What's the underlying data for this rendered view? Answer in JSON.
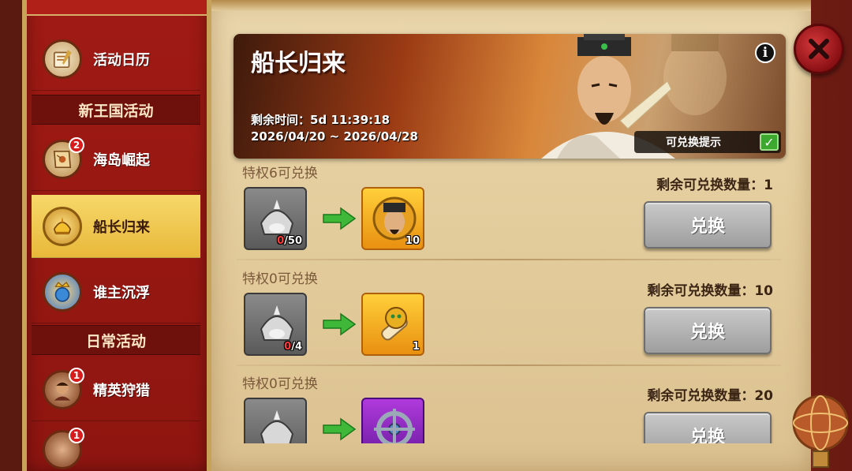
{
  "sidebar": {
    "items": [
      {
        "label": "活动日历",
        "badge": null,
        "active": false,
        "icon": "scroll-quill-icon"
      },
      {
        "label": "海岛崛起",
        "badge": "2",
        "active": false,
        "icon": "treasure-map-icon"
      },
      {
        "label": "船长归来",
        "badge": null,
        "active": true,
        "icon": "gold-helmet-icon"
      },
      {
        "label": "谁主沉浮",
        "badge": null,
        "active": false,
        "icon": "crown-globe-icon"
      },
      {
        "label": "精英狩猎",
        "badge": "1",
        "active": false,
        "icon": "warrior-portrait-icon"
      },
      {
        "label": "",
        "badge": "1",
        "active": false,
        "icon": "partial-avatar-icon"
      }
    ],
    "sections": [
      "新王国活动",
      "日常活动"
    ]
  },
  "banner": {
    "title": "船长归来",
    "remaining": "剩余时间：5d 11:39:18",
    "dates": "2026/04/20 ~ 2026/04/28",
    "info_icon": "i",
    "hint_label": "可兑换提示",
    "hint_checked": true
  },
  "rows": [
    {
      "title": "特权6可兑换",
      "remain": "剩余可兑换数量：1",
      "cost_have": "0",
      "cost_need": "/50",
      "reward_count": "10",
      "reward_type": "gold",
      "reward_icon": "captain-portrait-icon",
      "button": "兑换"
    },
    {
      "title": "特权0可兑换",
      "remain": "剩余可兑换数量：10",
      "cost_have": "0",
      "cost_need": "/4",
      "reward_count": "1",
      "reward_type": "gold",
      "reward_icon": "dragon-scroll-icon",
      "button": "兑换"
    },
    {
      "title": "特权0可兑换",
      "remain": "剩余可兑换数量：20",
      "cost_have": "",
      "cost_need": "",
      "reward_count": "",
      "reward_type": "purple",
      "reward_icon": "ship-wheel-icon",
      "button": "兑换"
    }
  ],
  "colors": {
    "sidebar_red": "#a01a14",
    "active_gold": "#f2cc52",
    "parchment": "#e6d1a4",
    "button_grey": "#b4b4b4",
    "arrow_green": "#3fb83a"
  }
}
